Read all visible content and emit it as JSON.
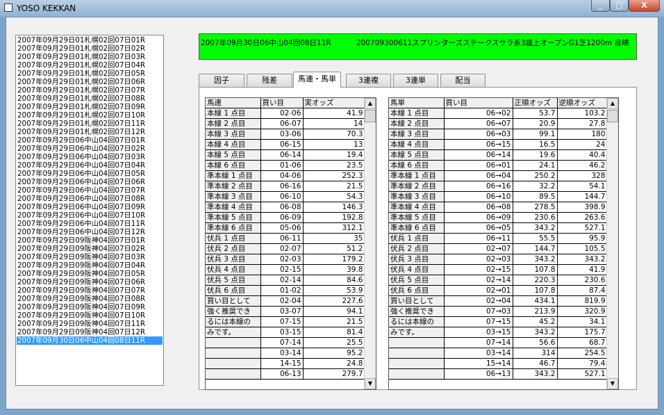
{
  "window": {
    "title": "YOSO KEKKAN"
  },
  "races": [
    "2007年09月29日01札幌02回07日01R",
    "2007年09月29日01札幌02回07日02R",
    "2007年09月29日01札幌02回07日03R",
    "2007年09月29日01札幌02回07日04R",
    "2007年09月29日01札幌02回07日05R",
    "2007年09月29日01札幌02回07日06R",
    "2007年09月29日01札幌02回07日07R",
    "2007年09月29日01札幌02回07日08R",
    "2007年09月29日01札幌02回07日09R",
    "2007年09月29日01札幌02回07日10R",
    "2007年09月29日01札幌02回07日11R",
    "2007年09月29日01札幌02回07日12R",
    "2007年09月29日06中山04回07日01R",
    "2007年09月29日06中山04回07日02R",
    "2007年09月29日06中山04回07日03R",
    "2007年09月29日06中山04回07日04R",
    "2007年09月29日06中山04回07日05R",
    "2007年09月29日06中山04回07日06R",
    "2007年09月29日06中山04回07日07R",
    "2007年09月29日06中山04回07日08R",
    "2007年09月29日06中山04回07日09R",
    "2007年09月29日06中山04回07日10R",
    "2007年09月29日06中山04回07日11R",
    "2007年09月29日06中山04回07日12R",
    "2007年09月29日09阪神04回07日01R",
    "2007年09月29日09阪神04回07日02R",
    "2007年09月29日09阪神04回07日03R",
    "2007年09月29日09阪神04回07日04R",
    "2007年09月29日09阪神04回07日05R",
    "2007年09月29日09阪神04回07日06R",
    "2007年09月29日09阪神04回07日07R",
    "2007年09月29日09阪神04回07日08R",
    "2007年09月29日09阪神04回07日09R",
    "2007年09月29日09阪神04回07日10R",
    "2007年09月29日09阪神04回07日11R",
    "2007年09月29日09阪神04回07日12R",
    "2007年09月30日06中山04回08日11R"
  ],
  "selected_race_index": 36,
  "header": {
    "race_id": "2007年09月30日06中山04回08日11R",
    "race_info": "200709300611スプリンターズステークスサラ系3歳上オープンG1芝1200m 良晴"
  },
  "tabs": [
    "因子",
    "残差",
    "馬連・馬単",
    "3連複",
    "3連単",
    "配当"
  ],
  "active_tab": 2,
  "umaren": {
    "columns": [
      "馬連",
      "買い目",
      "実オッズ"
    ],
    "rows": [
      [
        "本線 1 点目",
        "02-06",
        "41.9"
      ],
      [
        "本線 2 点目",
        "06-07",
        "14"
      ],
      [
        "本線 3 点目",
        "03-06",
        "70.3"
      ],
      [
        "本線 4 点目",
        "06-15",
        "13"
      ],
      [
        "本線 5 点目",
        "06-14",
        "19.4"
      ],
      [
        "本線 6 点目",
        "01-06",
        "23.5"
      ],
      [
        "準本線 1 点目",
        "04-06",
        "252.3"
      ],
      [
        "準本線 2 点目",
        "06-16",
        "21.5"
      ],
      [
        "準本線 3 点目",
        "06-10",
        "54.3"
      ],
      [
        "準本線 4 点目",
        "06-08",
        "146.3"
      ],
      [
        "準本線 5 点目",
        "06-09",
        "192.8"
      ],
      [
        "準本線 6 点目",
        "05-06",
        "312.1"
      ],
      [
        "伏兵 1 点目",
        "06-11",
        "35"
      ],
      [
        "伏兵 2 点目",
        "02-07",
        "51.2"
      ],
      [
        "伏兵 3 点目",
        "02-03",
        "179.2"
      ],
      [
        "伏兵 4 点目",
        "02-15",
        "39.8"
      ],
      [
        "伏兵 5 点目",
        "02-14",
        "84.6"
      ],
      [
        "伏兵 6 点目",
        "01-02",
        "53.9"
      ],
      [
        "買い目として",
        "02-04",
        "227.6"
      ],
      [
        "強く推奨でき",
        "03-07",
        "94.1"
      ],
      [
        "るには本線の",
        "07-15",
        "21.5"
      ],
      [
        "みです。",
        "03-15",
        "81.4"
      ],
      [
        "",
        "07-14",
        "25.5"
      ],
      [
        "",
        "03-14",
        "95.2"
      ],
      [
        "",
        "14-15",
        "24.8"
      ],
      [
        "",
        "06-13",
        "279.7"
      ]
    ]
  },
  "umatan": {
    "columns": [
      "馬単",
      "買い目",
      "正順オッズ",
      "逆順オッズ"
    ],
    "rows": [
      [
        "本線 1 点目",
        "06→02",
        "53.7",
        "103.2"
      ],
      [
        "本線 2 点目",
        "06→07",
        "20.9",
        "27.8"
      ],
      [
        "本線 3 点目",
        "06→03",
        "99.1",
        "180"
      ],
      [
        "本線 4 点目",
        "06→15",
        "16.5",
        "24"
      ],
      [
        "本線 5 点目",
        "06→14",
        "19.6",
        "40.4"
      ],
      [
        "本線 6 点目",
        "06→01",
        "24.1",
        "46.2"
      ],
      [
        "準本線 1 点目",
        "06→04",
        "250.2",
        "328"
      ],
      [
        "準本線 2 点目",
        "06→16",
        "32.2",
        "54.1"
      ],
      [
        "準本線 3 点目",
        "06→10",
        "89.5",
        "144.7"
      ],
      [
        "準本線 4 点目",
        "06→08",
        "278.5",
        "398.9"
      ],
      [
        "準本線 5 点目",
        "06→09",
        "230.6",
        "263.6"
      ],
      [
        "準本線 6 点目",
        "06→05",
        "343.2",
        "527.1"
      ],
      [
        "伏兵 1 点目",
        "06→11",
        "55.5",
        "95.9"
      ],
      [
        "伏兵 2 点目",
        "02→07",
        "144.7",
        "105.5"
      ],
      [
        "伏兵 3 点目",
        "02→03",
        "343.2",
        "343.2"
      ],
      [
        "伏兵 4 点目",
        "02→15",
        "107.8",
        "41.9"
      ],
      [
        "伏兵 5 点目",
        "02→14",
        "220.3",
        "230.6"
      ],
      [
        "伏兵 6 点目",
        "02→01",
        "107.8",
        "87.4"
      ],
      [
        "買い目として",
        "02→04",
        "434.1",
        "819.9"
      ],
      [
        "強く推奨でき",
        "07→03",
        "213.9",
        "320.9"
      ],
      [
        "るには本線の",
        "07→15",
        "45.2",
        "34.1"
      ],
      [
        "みです。",
        "03→15",
        "343.2",
        "175.7"
      ],
      [
        "",
        "07→14",
        "56.6",
        "68.7"
      ],
      [
        "",
        "03→14",
        "314",
        "254.5"
      ],
      [
        "",
        "15→14",
        "46.7",
        "79.4"
      ],
      [
        "",
        "06→13",
        "343.2",
        "527.1"
      ]
    ]
  },
  "icons": {
    "scroll_up": "▲",
    "scroll_down": "▼"
  }
}
